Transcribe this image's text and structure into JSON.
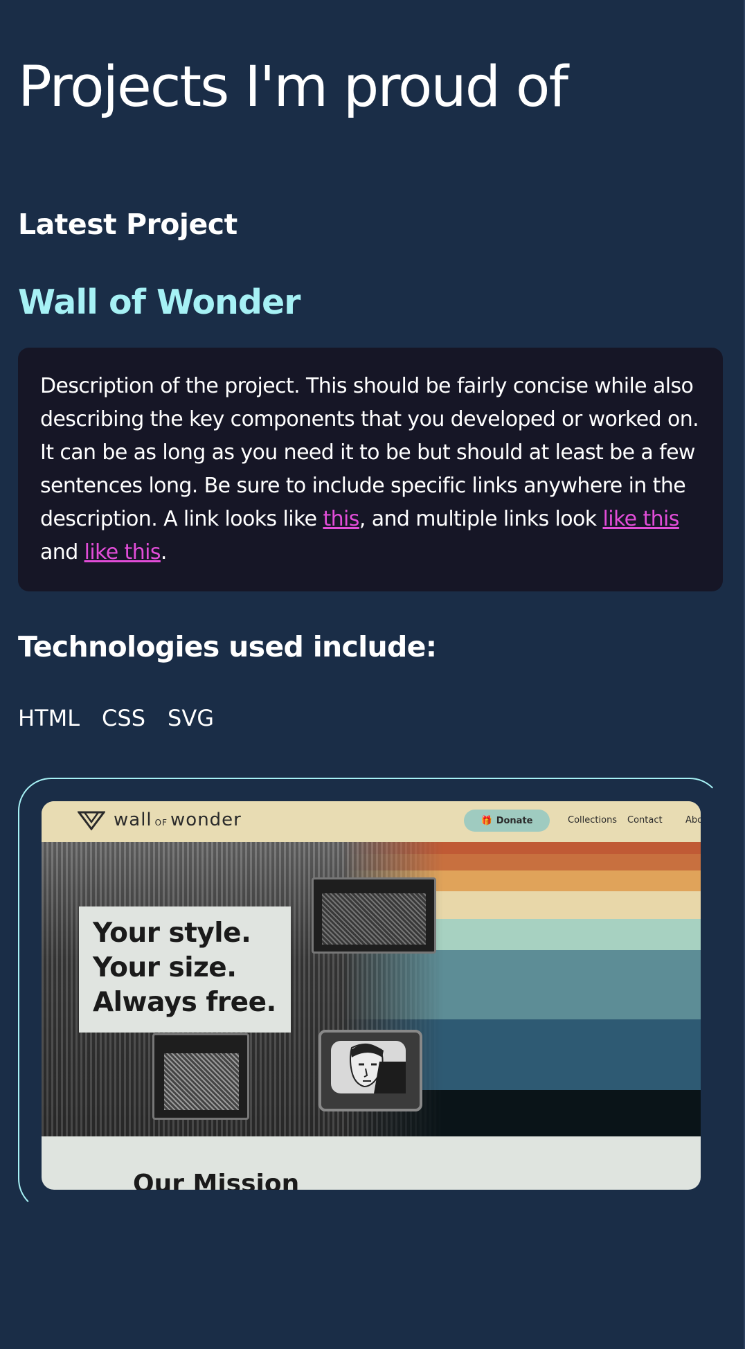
{
  "page": {
    "title": "Projects I'm proud of",
    "section_label": "Latest Project"
  },
  "project": {
    "title": "Wall of Wonder",
    "description_part1": "Description of the project. This should be fairly concise while also describing the key components that you developed or worked on. It can be as long as you need it to be but should at least be a few sentences long. Be sure to include specific links anywhere in the description. A link looks like ",
    "link1": "this",
    "description_part2": ", and multiple links look ",
    "link2": "like this",
    "description_part3": " and ",
    "link3": "like this",
    "description_part4": ".",
    "tech_heading": "Technologies used include:",
    "technologies": [
      "HTML",
      "CSS",
      "SVG"
    ]
  },
  "screenshot": {
    "logo_word1": "wall",
    "logo_of": "OF",
    "logo_word2": "wonder",
    "donate_label": "Donate",
    "nav_links": [
      "Collections",
      "Contact",
      "Abo"
    ],
    "tagline": [
      "Your style.",
      "Your size.",
      "Always free."
    ],
    "mission_heading": "Our Mission",
    "stripe_colors": [
      "#c05a35",
      "#c8703f",
      "#e0a35a",
      "#e8d7a9",
      "#a7d1c1",
      "#5d8d96",
      "#2e5a73",
      "#0a1418"
    ]
  },
  "colors": {
    "background": "#1a2d47",
    "accent_title": "#a6f1f5",
    "link": "#e24dd8",
    "card": "#161626"
  }
}
